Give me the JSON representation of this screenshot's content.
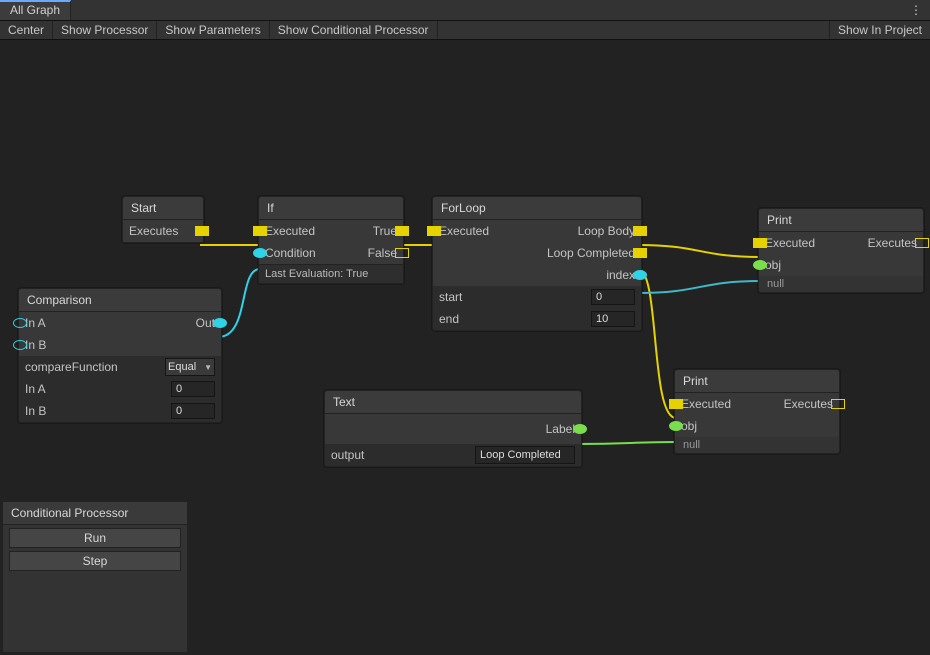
{
  "tabs": {
    "active": "All Graph",
    "menu_icon": "⋮"
  },
  "toolbar": {
    "center": "Center",
    "show_processor": "Show Processor",
    "show_parameters": "Show Parameters",
    "show_conditional": "Show Conditional Processor",
    "show_in_project": "Show In Project"
  },
  "nodes": {
    "start": {
      "title": "Start",
      "executes": "Executes"
    },
    "if": {
      "title": "If",
      "executed": "Executed",
      "condition": "Condition",
      "true": "True",
      "false": "False",
      "footer": "Last Evaluation: True"
    },
    "comparison": {
      "title": "Comparison",
      "in_a": "In A",
      "in_b": "In B",
      "out": "Out",
      "compare_label": "compareFunction",
      "compare_value": "Equal",
      "in_a_label": "In A",
      "in_a_value": "0",
      "in_b_label": "In B",
      "in_b_value": "0"
    },
    "forloop": {
      "title": "ForLoop",
      "executed": "Executed",
      "loop_body": "Loop Body",
      "loop_completed": "Loop Completed",
      "index": "index",
      "start_label": "start",
      "start_value": "0",
      "end_label": "end",
      "end_value": "10"
    },
    "print1": {
      "title": "Print",
      "executed": "Executed",
      "executes": "Executes",
      "obj": "obj",
      "null": "null"
    },
    "print2": {
      "title": "Print",
      "executed": "Executed",
      "executes": "Executes",
      "obj": "obj",
      "null": "null"
    },
    "text": {
      "title": "Text",
      "label": "Label",
      "output_label": "output",
      "output_value": "Loop Completed"
    }
  },
  "panel": {
    "title": "Conditional Processor",
    "run": "Run",
    "step": "Step"
  }
}
